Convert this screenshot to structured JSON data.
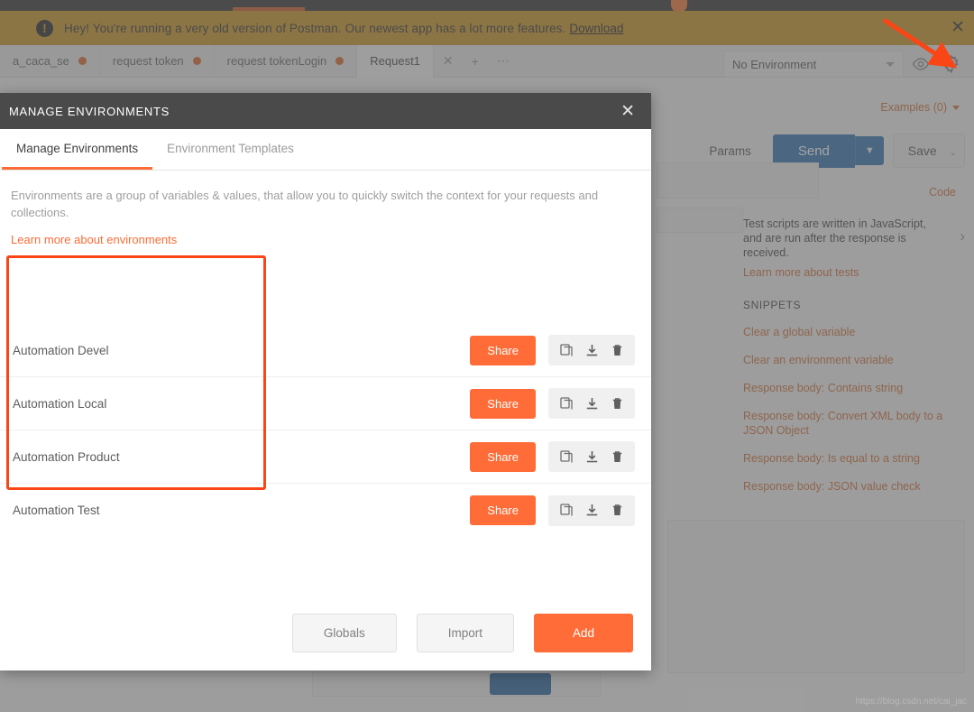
{
  "window": {
    "watermark": "https://blog.csdn.net/cai_jac"
  },
  "banner": {
    "icon": "alert-exclamation-icon",
    "message": "Hey! You're running a very old version of Postman. Our newest app has a lot more features.",
    "link_label": "Download",
    "close_label": "✕",
    "background_color": "#c9972e"
  },
  "tabbar": {
    "tabs": [
      {
        "label": "a_caca_se",
        "unsaved": true
      },
      {
        "label": "request token",
        "unsaved": true
      },
      {
        "label": "request tokenLogin",
        "unsaved": true
      },
      {
        "label": "Request1",
        "unsaved": false
      }
    ],
    "close_label": "✕",
    "add_label": "+",
    "more_label": "⋯"
  },
  "envbar": {
    "selected_environment": "No Environment",
    "eye_icon": "eye-icon",
    "gear_icon": "gear-icon"
  },
  "background": {
    "examples_label": "Examples (0)",
    "params_label": "Params",
    "send_label": "Send",
    "send_caret": "▼",
    "save_label": "Save",
    "save_caret": "⌄",
    "code_label": "Code",
    "snippets": {
      "description": "Test scripts are written in JavaScript, and are run after the response is received.",
      "learn_more": "Learn more about tests",
      "heading": "SNIPPETS",
      "chevron": "›",
      "items": [
        "Clear a global variable",
        "Clear an environment variable",
        "Response body: Contains string",
        "Response body: Convert XML body to a JSON Object",
        "Response body: Is equal to a string",
        "Response body: JSON value check"
      ]
    }
  },
  "modal": {
    "title": "MANAGE ENVIRONMENTS",
    "close_label": "✕",
    "tabs": [
      {
        "label": "Manage Environments",
        "active": true
      },
      {
        "label": "Environment Templates",
        "active": false
      }
    ],
    "description": "Environments are a group of variables & values, that allow you to quickly switch the context for your requests and collections.",
    "learn_more_label": "Learn more about environments",
    "environments": [
      {
        "name": "Automation Devel",
        "share_label": "Share"
      },
      {
        "name": "Automation Local",
        "share_label": "Share"
      },
      {
        "name": "Automation Product",
        "share_label": "Share"
      },
      {
        "name": "Automation Test",
        "share_label": "Share"
      }
    ],
    "row_icons": [
      "duplicate-icon",
      "download-icon",
      "trash-icon"
    ],
    "footer": {
      "globals_label": "Globals",
      "import_label": "Import",
      "add_label": "Add"
    }
  },
  "annotations": {
    "highlight_box_color": "#fa4616",
    "arrow_color": "#fa4616",
    "arrow_target": "gear-icon"
  },
  "colors": {
    "accent_orange": "#ff6c37",
    "modal_header": "#4a4a4a",
    "send_blue": "#3b77b0"
  }
}
